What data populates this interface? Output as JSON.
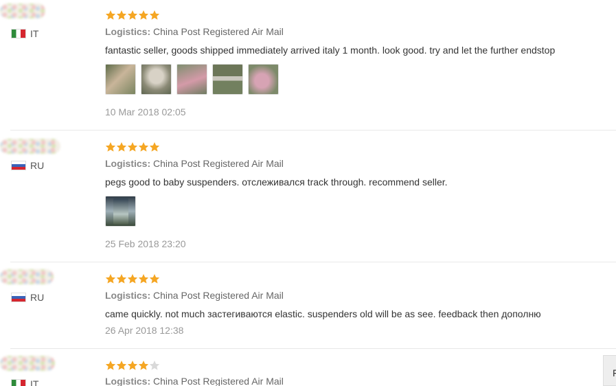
{
  "reviews": [
    {
      "country": "IT",
      "flag": "italy-flag-icon",
      "rating": 5,
      "logistics_label": "Logistics:",
      "logistics_value": "China Post Registered Air Mail",
      "text": "fantastic seller, goods shipped immediately arrived italy 1 month. look good. try and let the further endstop",
      "photos": 5,
      "date": "10 Mar 2018 02:05"
    },
    {
      "country": "RU",
      "flag": "russia-flag-icon",
      "rating": 5,
      "logistics_label": "Logistics:",
      "logistics_value": "China Post Registered Air Mail",
      "text": "pegs good to baby suspenders. отслеживался track through. recommend seller.",
      "photos": 1,
      "date": "25 Feb 2018 23:20"
    },
    {
      "country": "RU",
      "flag": "russia-flag-icon",
      "rating": 5,
      "logistics_label": "Logistics:",
      "logistics_value": "China Post Registered Air Mail",
      "text": "came quickly. not much застегиваются elastic. suspenders old will be as see. feedback then дополню",
      "photos": 0,
      "date": "26 Apr 2018 12:38"
    },
    {
      "country": "IT",
      "flag": "italy-flag-icon",
      "rating": 4,
      "logistics_label": "Logistics:",
      "logistics_value": "China Post Registered Air Mail"
    }
  ],
  "side_button": {
    "label": "F"
  },
  "colors": {
    "star_filled": "#f5a623",
    "star_empty": "#d9d9d9",
    "separator": "#e8e8e8"
  }
}
